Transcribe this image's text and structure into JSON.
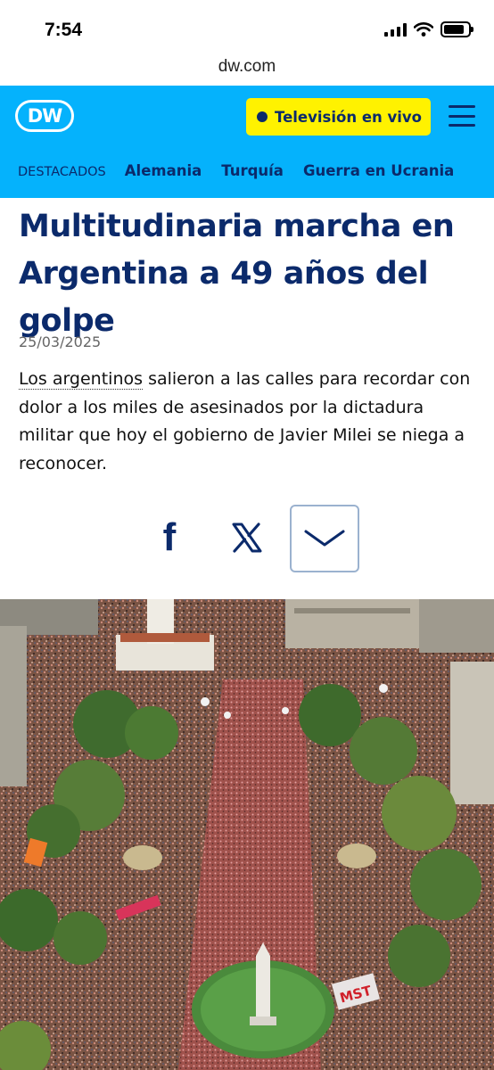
{
  "status_bar": {
    "time": "7:54"
  },
  "browser": {
    "url": "dw.com"
  },
  "header": {
    "logo": "DW",
    "live_button": "Televisión en vivo",
    "nav": {
      "featured": "DESTACADOS",
      "items": [
        "Alemania",
        "Turquía",
        "Guerra en Ucrania"
      ]
    }
  },
  "article": {
    "headline": "Multitudinaria marcha en Argentina a 49 años del golpe",
    "date": "25/03/2025",
    "lead_link": "Los argentinos",
    "lead_rest": " salieron a las calles para recordar con dolor a los miles de asesinados por la dictadura militar que hoy el gobierno de Javier Milei se niega a reconocer."
  },
  "share": {
    "facebook_glyph": "f"
  },
  "image": {
    "banner_text": "MST"
  },
  "colors": {
    "brand_blue": "#05b2fc",
    "navy": "#0b2a6b",
    "live_yellow": "#fff200"
  },
  "icons": [
    "wifi-icon",
    "battery-icon",
    "signal-icon",
    "dw-logo",
    "live-dot-icon",
    "menu-icon",
    "facebook-icon",
    "x-icon",
    "chevron-down-icon"
  ]
}
